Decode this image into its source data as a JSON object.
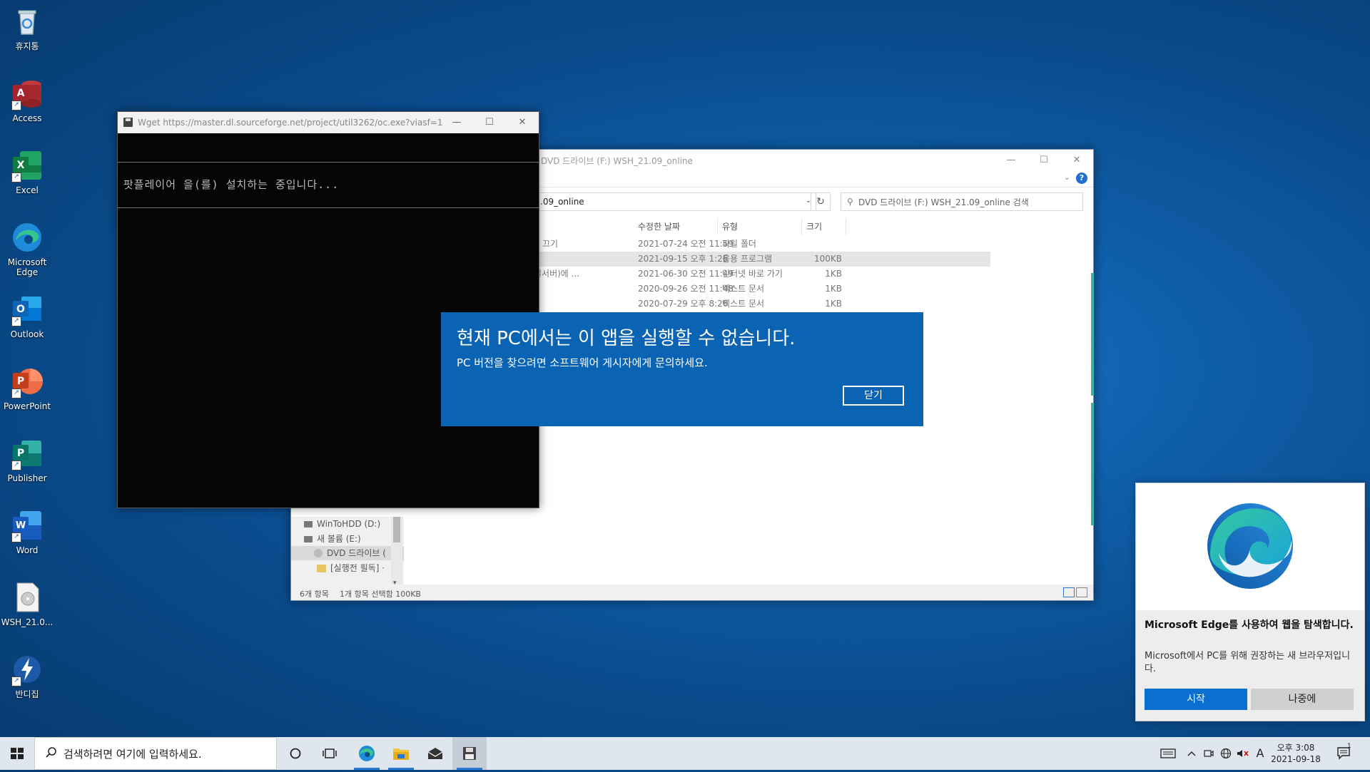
{
  "desktop": {
    "icons": [
      {
        "label": "휴지통",
        "icon": "recycle-bin-icon"
      },
      {
        "label": "Access",
        "icon": "access-icon",
        "letter": "A",
        "color": "#b32a2e"
      },
      {
        "label": "Excel",
        "icon": "excel-icon",
        "letter": "X",
        "color": "#1d7044"
      },
      {
        "label": "Microsoft Edge",
        "icon": "edge-icon"
      },
      {
        "label": "Outlook",
        "icon": "outlook-icon",
        "letter": "O",
        "color": "#0f64b8"
      },
      {
        "label": "PowerPoint",
        "icon": "powerpoint-icon",
        "letter": "P",
        "color": "#c4462a"
      },
      {
        "label": "Publisher",
        "icon": "publisher-icon",
        "letter": "P",
        "color": "#0b7a73"
      },
      {
        "label": "Word",
        "icon": "word-icon",
        "letter": "W",
        "color": "#1f5bb0"
      },
      {
        "label": "WSH_21.0...",
        "icon": "disc-image-icon"
      },
      {
        "label": "반디집",
        "icon": "bandizip-icon"
      }
    ]
  },
  "explorer": {
    "title": "DVD 드라이브 (F:) WSH_21.09_online",
    "address": ".09_online",
    "search_placeholder": "DVD 드라이브 (F:) WSH_21.09_online 검색",
    "help": "?",
    "columns": {
      "date": "수정한 날짜",
      "type": "유형",
      "size": "크기"
    },
    "files": [
      {
        "name": "끄기",
        "date": "2021-07-24 오전 11:59",
        "type": "파일 폴더",
        "size": ""
      },
      {
        "name": "",
        "date": "2021-09-15 오후 1:26",
        "type": "응용 프로그램",
        "size": "100KB",
        "selected": true
      },
      {
        "name": "일서버)에 ...",
        "date": "2021-06-30 오전 11:49",
        "type": "인터넷 바로 가기",
        "size": "1KB"
      },
      {
        "name": "",
        "date": "2020-09-26 오전 11:48",
        "type": "텍스트 문서",
        "size": "1KB"
      },
      {
        "name": "",
        "date": "2020-07-29 오후 8:26",
        "type": "텍스트 문서",
        "size": "1KB"
      }
    ],
    "nav": [
      {
        "label": "WinToHDD (D:)"
      },
      {
        "label": "새 볼륨 (E:)"
      },
      {
        "label": "DVD 드라이브 (",
        "selected": true
      },
      {
        "label": "[실행전 필독] ·"
      }
    ],
    "status": {
      "count": "6개 항목",
      "selection": "1개 항목 선택함 100KB"
    }
  },
  "console": {
    "title": "Wget https://master.dl.sourceforge.net/project/util3262/oc.exe?viasf=1",
    "message": "팟플레이어 을(를) 설치하는 중입니다..."
  },
  "dialog": {
    "title": "현재 PC에서는 이 앱을 실행할 수 없습니다.",
    "message": "PC 버전을 찾으려면 소프트웨어 게시자에게 문의하세요.",
    "button": "닫기"
  },
  "toast": {
    "heading": "Microsoft Edge를 사용하여 웹을 탐색합니다.",
    "body": "Microsoft에서 PC를 위해 권장하는 새 브라우저입니다.",
    "primary": "시작",
    "secondary": "나중에"
  },
  "taskbar": {
    "search_placeholder": "검색하려면 여기에 입력하세요.",
    "ime": "A",
    "time": "오후 3:08",
    "date": "2021-09-18",
    "notification_count": "1"
  }
}
